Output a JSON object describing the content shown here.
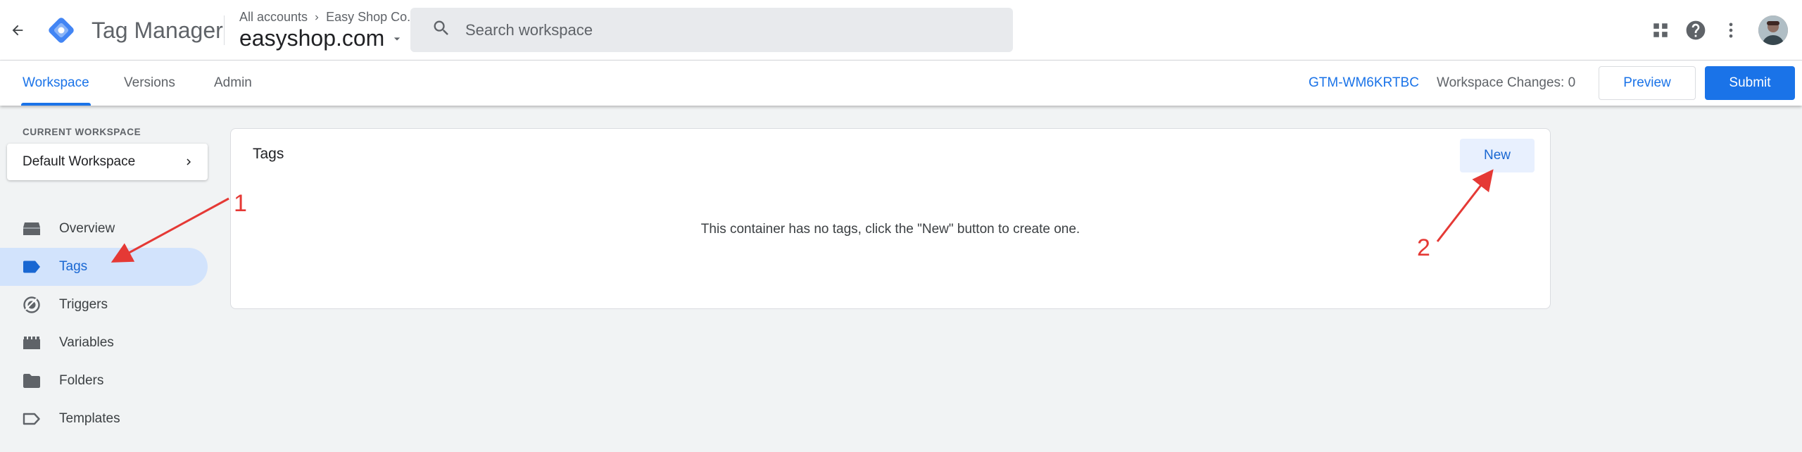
{
  "app": {
    "product_name": "Tag Manager",
    "breadcrumb": {
      "accounts": "All accounts",
      "account": "Easy Shop Co."
    },
    "container_name": "easyshop.com"
  },
  "search": {
    "placeholder": "Search workspace",
    "value": ""
  },
  "top_icons": [
    "apps-grid-icon",
    "help-icon",
    "more-vert-icon",
    "avatar"
  ],
  "tabs": [
    {
      "label": "Workspace",
      "active": true
    },
    {
      "label": "Versions",
      "active": false
    },
    {
      "label": "Admin",
      "active": false
    }
  ],
  "container_id": "GTM-WM6KRTBC",
  "workspace_changes": "Workspace Changes: 0",
  "actions": {
    "preview": "Preview",
    "submit": "Submit"
  },
  "sidebar": {
    "current_workspace_label": "CURRENT WORKSPACE",
    "workspace_name": "Default Workspace",
    "items": [
      {
        "label": "Overview",
        "icon": "overview-icon",
        "active": false
      },
      {
        "label": "Tags",
        "icon": "tag-icon",
        "active": true
      },
      {
        "label": "Triggers",
        "icon": "trigger-icon",
        "active": false
      },
      {
        "label": "Variables",
        "icon": "variables-icon",
        "active": false
      },
      {
        "label": "Folders",
        "icon": "folder-icon",
        "active": false
      },
      {
        "label": "Templates",
        "icon": "template-icon",
        "active": false
      }
    ]
  },
  "main": {
    "title": "Tags",
    "new_button": "New",
    "empty_message": "This container has no tags, click the \"New\" button to create one."
  },
  "annotations": [
    {
      "label": "1"
    },
    {
      "label": "2"
    }
  ],
  "colors": {
    "accent": "#1a73e8",
    "active_nav_bg": "#d2e3fc",
    "annotation": "#e53935"
  }
}
